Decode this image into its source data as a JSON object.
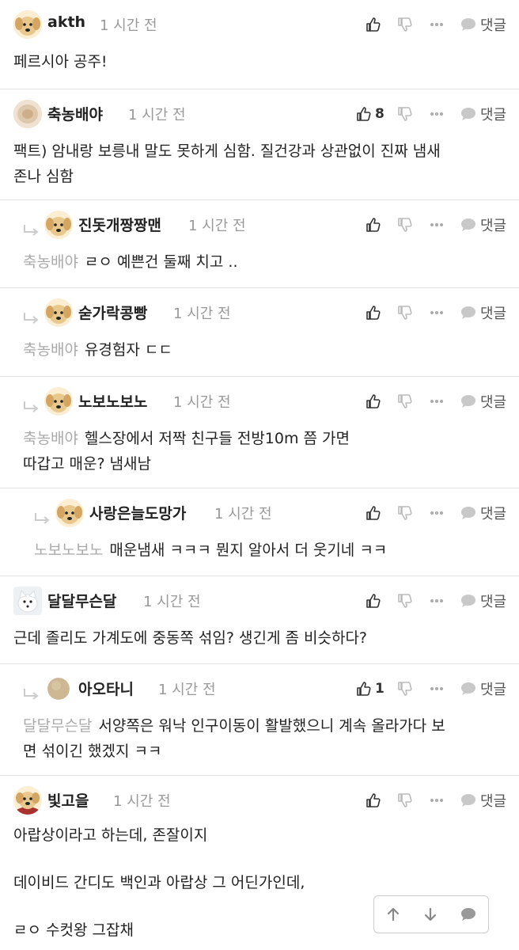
{
  "labels": {
    "reply": "댓글"
  },
  "comments": [
    {
      "nick": "akth",
      "time": "1 시간 전",
      "likes": "",
      "lines": [
        "페르시아 공주!"
      ],
      "mention": ""
    },
    {
      "nick": "축농배야",
      "time": "1 시간 전",
      "likes": "8",
      "lines": [
        "팩트) 암내랑 보릉내 말도 못하게 심함. 질건강과 상관없이 진짜 냄새",
        "존나 심함"
      ],
      "mention": ""
    },
    {
      "nick": "진돗개짱짱맨",
      "time": "1 시간 전",
      "likes": "",
      "lines": [
        "ㄹㅇ 예쁜건 둘째 치고 .."
      ],
      "mention": "축농배야"
    },
    {
      "nick": "숟가락콩빵",
      "time": "1 시간 전",
      "likes": "",
      "lines": [
        "유경험자 ㄷㄷ"
      ],
      "mention": "축농배야"
    },
    {
      "nick": "노보노보노",
      "time": "1 시간 전",
      "likes": "",
      "lines": [
        "헬스장에서 저짝 친구들 전방10m 쯤 가면",
        "따갑고 매운? 냄새남"
      ],
      "mention": "축농배야"
    },
    {
      "nick": "사랑은늘도망가",
      "time": "1 시간 전",
      "likes": "",
      "lines": [
        "매운냄새 ㅋㅋㅋ 뭔지 알아서 더 웃기네 ㅋㅋ"
      ],
      "mention": "노보노보노"
    },
    {
      "nick": "달달무슨달",
      "time": "1 시간 전",
      "likes": "",
      "lines": [
        "근데 졸리도 가계도에 중동쪽 섞임? 생긴게 좀 비슷하다?"
      ],
      "mention": ""
    },
    {
      "nick": "아오타니",
      "time": "1 시간 전",
      "likes": "1",
      "lines": [
        "서양쪽은 워낙 인구이동이 활발했으니 계속 올라가다 보",
        "면 섞이긴 했겠지 ㅋㅋ"
      ],
      "mention": "달달무슨달"
    },
    {
      "nick": "빛고을",
      "time": "1 시간 전",
      "likes": "",
      "lines": [
        "아랍상이라고 하는데, 존잘이지",
        "",
        "데이비드 간디도 백인과 아랍상 그 어딘가인데,",
        "",
        "ㄹㅇ 수컷왕 그잡채"
      ],
      "mention": ""
    }
  ]
}
